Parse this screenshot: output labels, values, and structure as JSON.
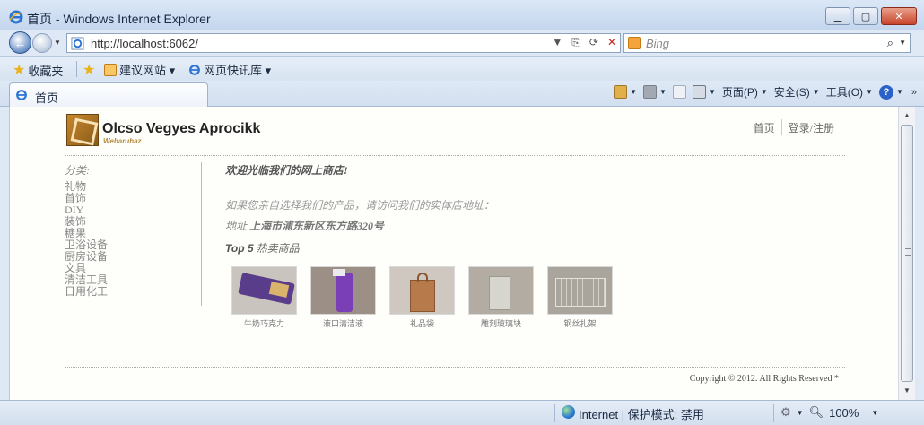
{
  "window": {
    "title": "首页 - Windows Internet Explorer"
  },
  "addressbar": {
    "url": "http://localhost:6062/",
    "search_placeholder": "Bing"
  },
  "favorites": {
    "favorites_label": "收藏夹",
    "suggested_sites_label": "建议网站 ▾",
    "web_slice_gallery_label": "网页快讯库 ▾"
  },
  "tab": {
    "label": "首页"
  },
  "commandbar": {
    "page_label": "页面(P)",
    "safety_label": "安全(S)",
    "tools_label": "工具(O)"
  },
  "site": {
    "name": "Olcso Vegyes Aprocikk",
    "subname": "Webaruhaz",
    "nav": {
      "home": "首页",
      "login": "登录/注册"
    },
    "categories_title": "分类:",
    "categories": [
      "礼物",
      "首饰",
      "DIY",
      "装饰",
      "糖果",
      "卫浴设备",
      "厨房设备",
      "文具",
      "清洁工具",
      "日用化工"
    ],
    "welcome": "欢迎光临我们的网上商店!",
    "intro": "如果您亲自选择我们的产品，请访问我们的实体店地址：",
    "address_label": "地址",
    "address": "上海市浦东新区东方路320号",
    "top_prefix": "Top 5",
    "top_title": "热卖商品",
    "products": [
      {
        "name": "牛奶巧克力"
      },
      {
        "name": "液口清洁液"
      },
      {
        "name": "礼品袋"
      },
      {
        "name": "雕刻玻璃块"
      },
      {
        "name": "钢丝扎架"
      }
    ],
    "copyright": "Copyright © 2012. All Rights Reserved *"
  },
  "statusbar": {
    "zone_text": "Internet | 保护模式: 禁用",
    "zoom_text": "100%"
  }
}
